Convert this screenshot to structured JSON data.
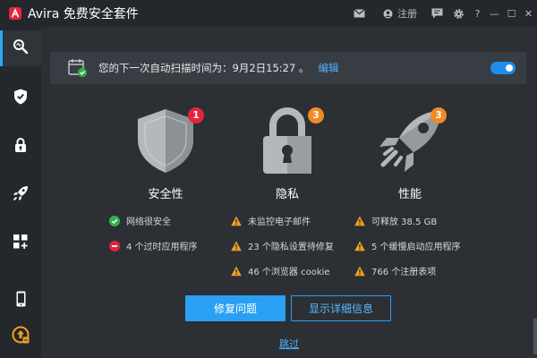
{
  "titlebar": {
    "app_name": "Avira",
    "suite_name": "免费安全套件",
    "register_label": "注册",
    "help_label": "?",
    "minimize_label": "—",
    "maximize_label": "☐",
    "close_label": "✕"
  },
  "sidebar": {
    "items": [
      {
        "icon": "scan-icon",
        "active": true
      },
      {
        "icon": "shield-icon",
        "active": false
      },
      {
        "icon": "lock-icon",
        "active": false
      },
      {
        "icon": "rocket-icon",
        "active": false
      },
      {
        "icon": "apps-icon",
        "active": false
      },
      {
        "icon": "mobile-icon",
        "active": false
      },
      {
        "icon": "upgrade-icon",
        "active": false
      }
    ]
  },
  "banner": {
    "text": "您的下一次自动扫描时间为：9月2日15:27 。",
    "edit_label": "编辑",
    "toggle_on": true
  },
  "categories": [
    {
      "label": "安全性",
      "icon": "shield-icon",
      "badge": "1",
      "badge_color": "#e5243b",
      "items": [
        {
          "status": "ok",
          "text": "网络很安全"
        },
        {
          "status": "error",
          "text": "4 个过时应用程序"
        }
      ]
    },
    {
      "label": "隐私",
      "icon": "padlock-icon",
      "badge": "3",
      "badge_color": "#f08a24",
      "items": [
        {
          "status": "warning",
          "text": "未监控电子邮件"
        },
        {
          "status": "warning",
          "text": "23 个隐私设置待修复"
        },
        {
          "status": "warning",
          "text": "46 个浏览器 cookie"
        }
      ]
    },
    {
      "label": "性能",
      "icon": "rocket-icon",
      "badge": "3",
      "badge_color": "#f08a24",
      "items": [
        {
          "status": "warning",
          "text": "可释放 38.5 GB"
        },
        {
          "status": "warning",
          "text": "5 个缓慢启动应用程序"
        },
        {
          "status": "warning",
          "text": "766 个注册表项"
        }
      ]
    }
  ],
  "actions": {
    "fix_label": "修复问题",
    "details_label": "显示详细信息",
    "skip_label": "跳过"
  },
  "colors": {
    "accent": "#2aa0f4",
    "background": "#2c3035",
    "sidebar": "#24272b",
    "ok": "#2fb34a",
    "error": "#e5243b",
    "warning": "#f0a020"
  }
}
